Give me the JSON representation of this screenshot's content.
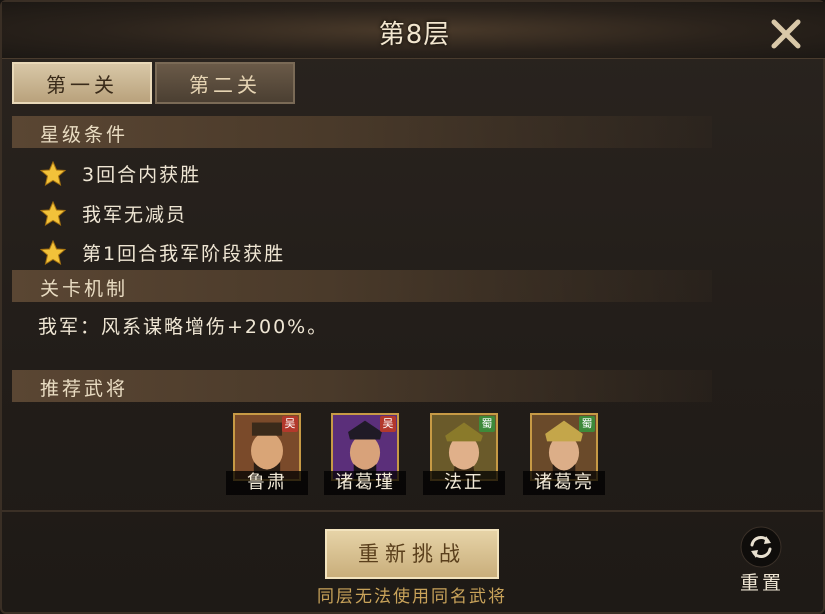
{
  "window": {
    "title": "第8层"
  },
  "tabs": [
    {
      "label": "第一关",
      "active": true
    },
    {
      "label": "第二关",
      "active": false
    }
  ],
  "sections": {
    "star_conditions": "星级条件",
    "mechanism": "关卡机制",
    "recommended": "推荐武将"
  },
  "conditions": [
    {
      "text": "3回合内获胜",
      "icon": "star-icon"
    },
    {
      "text": "我军无减员",
      "icon": "star-icon"
    },
    {
      "text": "第1回合我军阶段获胜",
      "icon": "star-icon"
    }
  ],
  "mechanism_text": "我军：风系谋略增伤+200%。",
  "heroes": [
    {
      "name": "鲁肃",
      "faction": "吴",
      "faction_color": "#b3392c",
      "bg": "#7a4a2a"
    },
    {
      "name": "诸葛瑾",
      "faction": "吴",
      "faction_color": "#b3392c",
      "bg": "#5b2f7a"
    },
    {
      "name": "法正",
      "faction": "蜀",
      "faction_color": "#3e8a3a",
      "bg": "#6a5a2a"
    },
    {
      "name": "诸葛亮",
      "faction": "蜀",
      "faction_color": "#3e8a3a",
      "bg": "#6a4a2a"
    }
  ],
  "footer": {
    "retry_label": "重新挑战",
    "hint": "同层无法使用同名武将",
    "reset_label": "重置"
  },
  "colors": {
    "accent_gold": "#c9a35a",
    "text_light": "#efe6d4",
    "button_bg": "#d8c29a"
  }
}
